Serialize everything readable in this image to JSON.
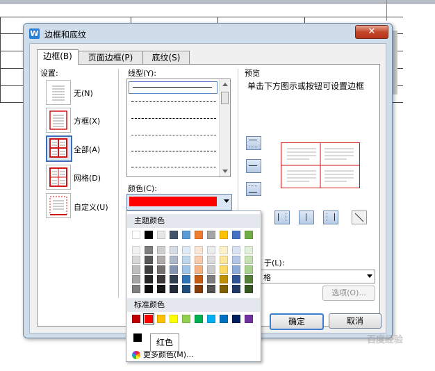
{
  "dialog": {
    "title": "边框和底纹",
    "close_glyph": "✕",
    "app_icon_letter": "W"
  },
  "tabs": [
    {
      "label": "边框(B)",
      "active": true
    },
    {
      "label": "页面边框(P)",
      "active": false
    },
    {
      "label": "底纹(S)",
      "active": false
    }
  ],
  "settings": {
    "heading": "设置:",
    "items": [
      {
        "label": "无(N)",
        "selected": false
      },
      {
        "label": "方框(X)",
        "selected": false
      },
      {
        "label": "全部(A)",
        "selected": true
      },
      {
        "label": "网格(D)",
        "selected": false
      },
      {
        "label": "自定义(U)",
        "selected": false
      }
    ]
  },
  "line_style": {
    "heading": "线型(Y):",
    "styles": [
      "solid",
      "dotted",
      "dashed",
      "dash-dot",
      "long-dash",
      "dash-dot-dot"
    ],
    "selected_index": 0
  },
  "color": {
    "heading": "颜色(C):",
    "selected_hex": "#ff0000"
  },
  "preview": {
    "heading": "预览",
    "instruction": "单击下方图示或按钮可设置边框"
  },
  "apply_to": {
    "label_fragment": "于(L):",
    "value_fragment": "格"
  },
  "buttons": {
    "options": "选项(O)...",
    "ok": "确定",
    "cancel": "取消"
  },
  "color_popup": {
    "theme_heading": "主题颜色",
    "theme_row": [
      "#ffffff",
      "#000000",
      "#e7e6e6",
      "#44546a",
      "#5b9bd5",
      "#ed7d31",
      "#a5a5a5",
      "#ffc000",
      "#4472c4",
      "#70ad47"
    ],
    "shade_rows": [
      [
        "#f2f2f2",
        "#7f7f7f",
        "#d0cece",
        "#d6dce4",
        "#deebf6",
        "#fbe5d5",
        "#ededed",
        "#fff2cc",
        "#dae3f3",
        "#e2efd9"
      ],
      [
        "#d8d8d8",
        "#595959",
        "#aeaaaa",
        "#adb9ca",
        "#bdd7ee",
        "#f7cbac",
        "#dbdbdb",
        "#fee599",
        "#b4c6e7",
        "#c5e0b3"
      ],
      [
        "#bfbfbf",
        "#3f3f3f",
        "#757070",
        "#8496b0",
        "#9dc3e6",
        "#f4b183",
        "#c9c9c9",
        "#ffd965",
        "#8eaadb",
        "#a8d08d"
      ],
      [
        "#a5a5a5",
        "#262626",
        "#3a3838",
        "#323f4f",
        "#2e75b5",
        "#c55a11",
        "#7b7b7b",
        "#bf9000",
        "#2f5496",
        "#538135"
      ],
      [
        "#7f7f7f",
        "#0c0c0c",
        "#171616",
        "#222a35",
        "#1e4e79",
        "#843c0b",
        "#525252",
        "#7f6000",
        "#1f3864",
        "#375623"
      ]
    ],
    "standard_heading": "标准颜色",
    "standard_row": [
      "#c00000",
      "#ff0000",
      "#ffc000",
      "#ffff00",
      "#92d050",
      "#00b050",
      "#00b0f0",
      "#0070c0",
      "#002060",
      "#7030a0"
    ],
    "standard_selected_index": 1,
    "recent_swatch": "#000000",
    "tooltip": "红色",
    "more_colors": "更多颜色(M)..."
  },
  "watermark": "百度经验"
}
